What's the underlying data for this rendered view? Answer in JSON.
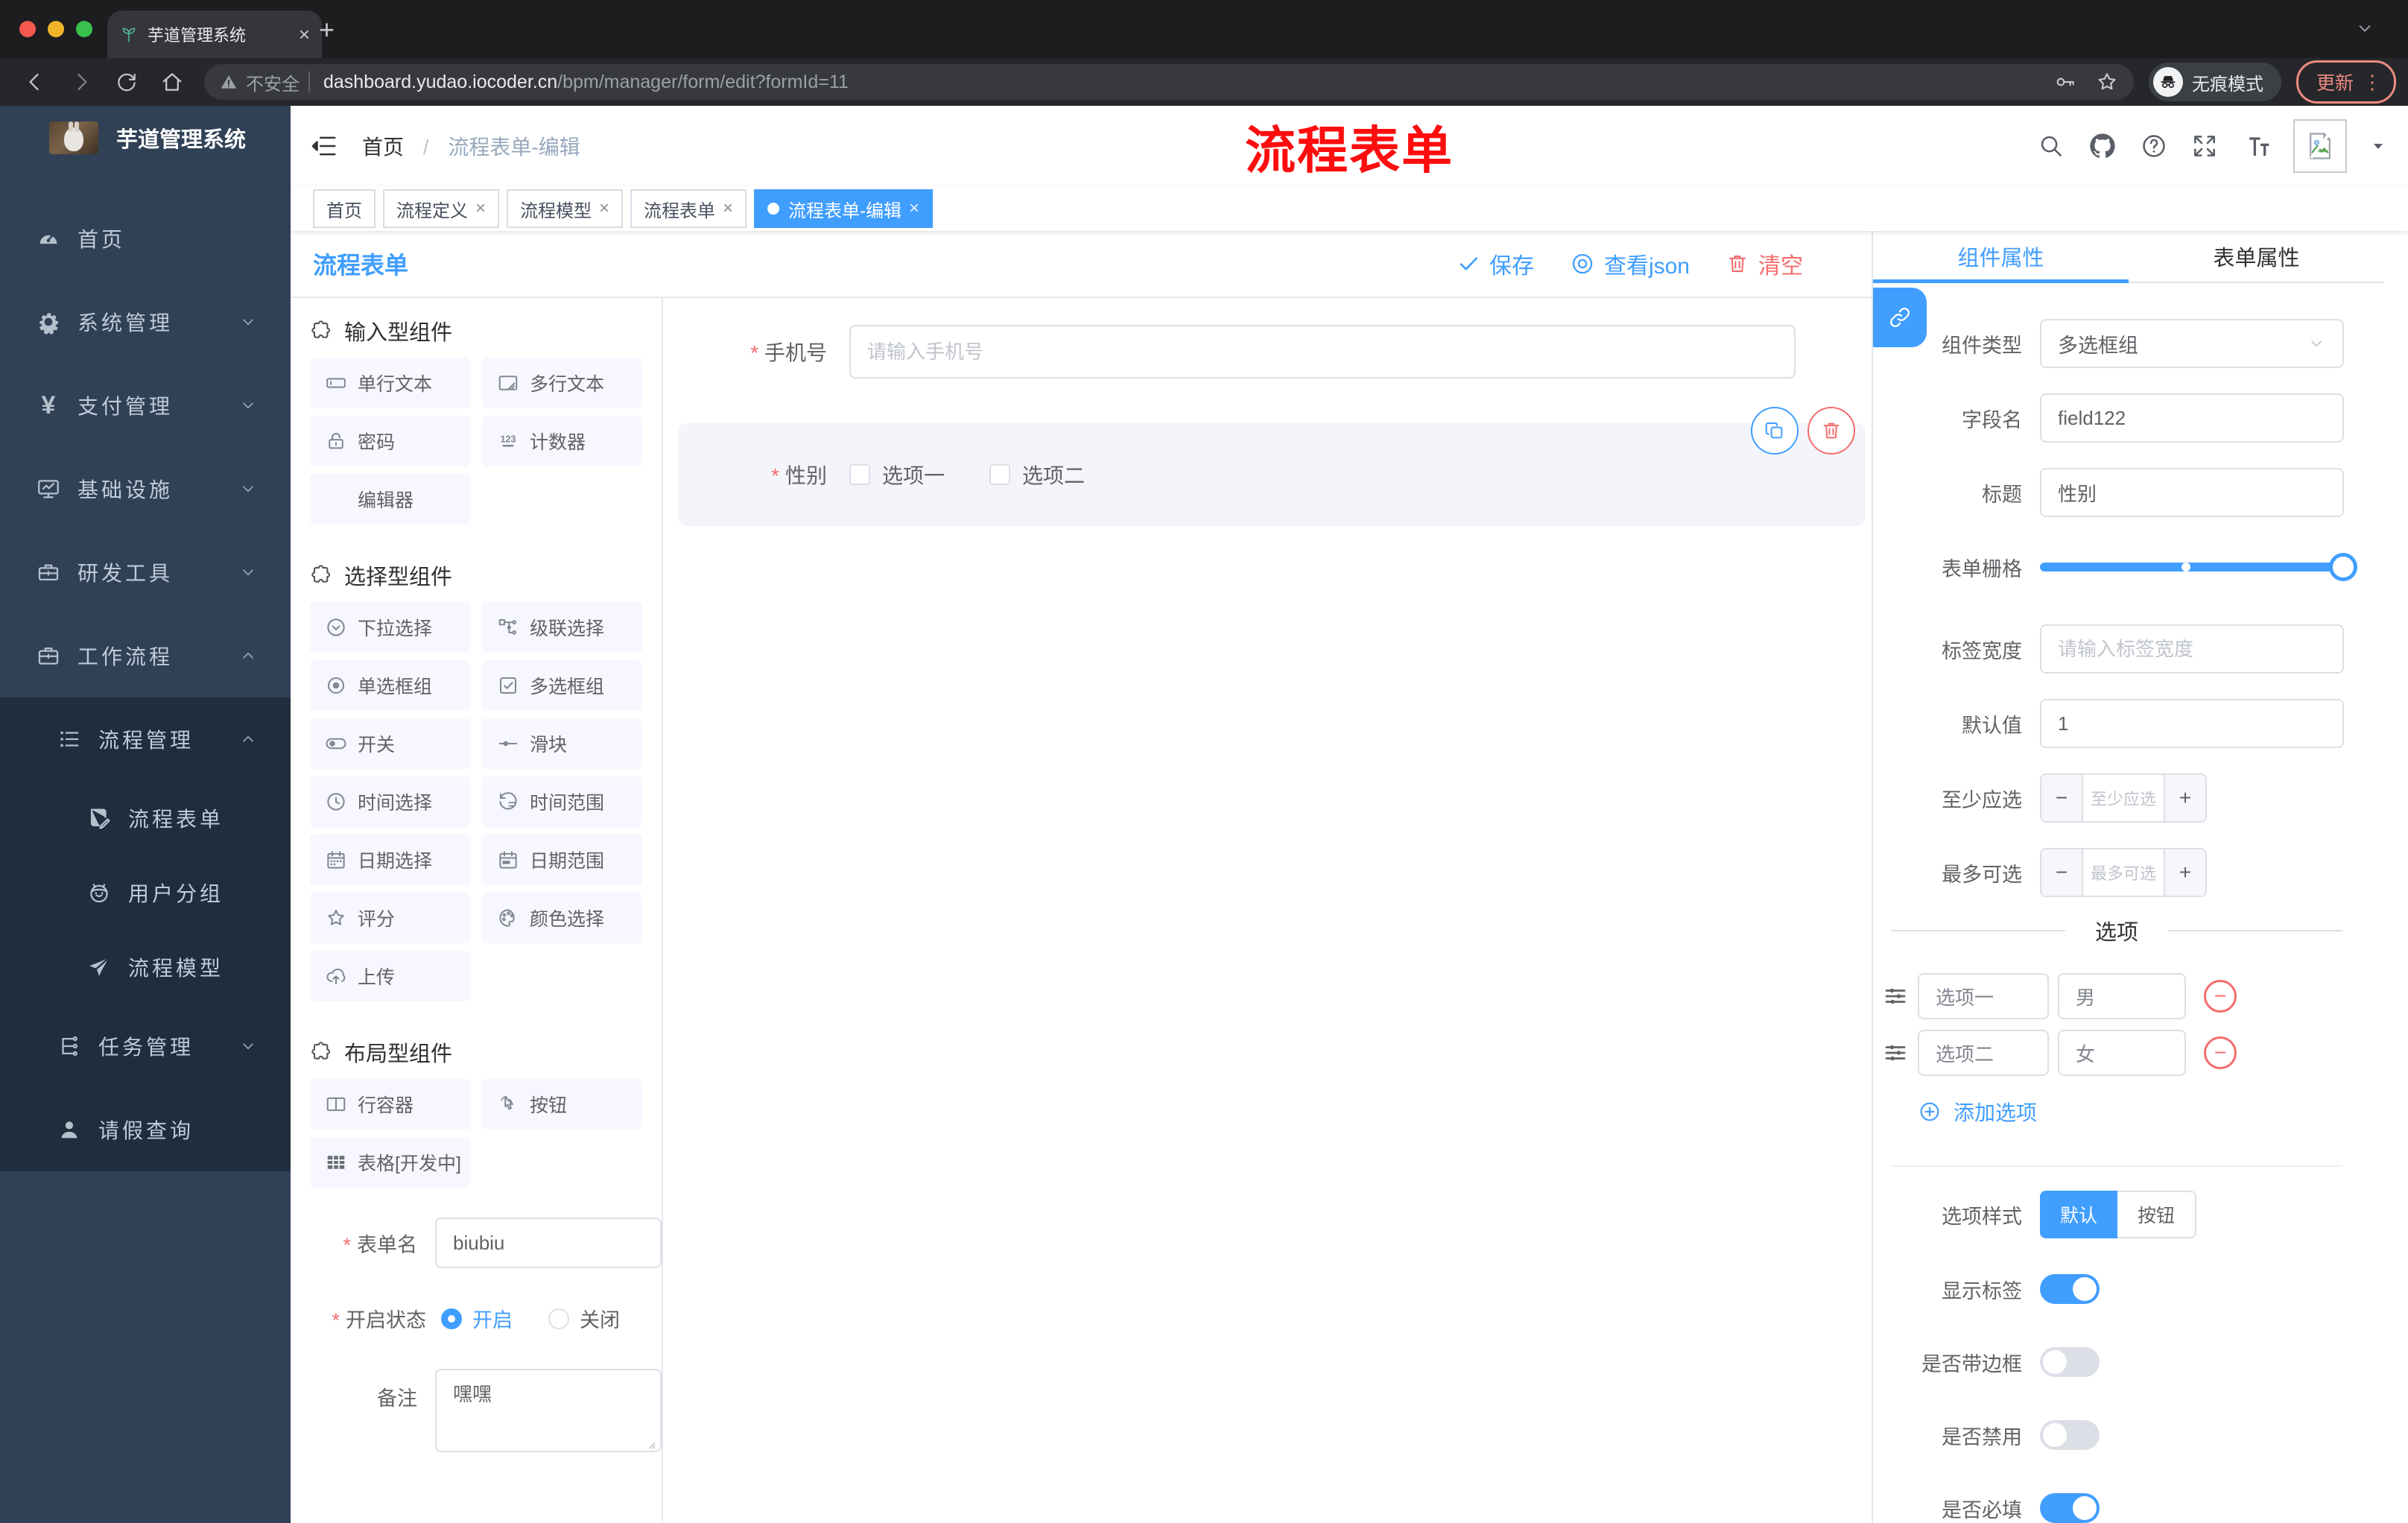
{
  "colors": {
    "accent": "#409EFF",
    "danger": "#F56C6C",
    "sidebar_bg": "#304156",
    "submenu_bg": "#1F2D3D",
    "tab_active_bg": "#409EFF"
  },
  "browser": {
    "tab_title": "芋道管理系统",
    "not_secure": "不安全",
    "url_domain": "dashboard.yudao.iocoder.cn",
    "url_path": "/bpm/manager/form/edit?formId=11",
    "incognito_label": "无痕模式",
    "update_label": "更新"
  },
  "sidebar": {
    "title": "芋道管理系统",
    "items": [
      {
        "label": "首页"
      },
      {
        "label": "系统管理"
      },
      {
        "label": "支付管理"
      },
      {
        "label": "基础设施"
      },
      {
        "label": "研发工具"
      },
      {
        "label": "工作流程"
      },
      {
        "label": "流程管理"
      },
      {
        "label": "流程表单"
      },
      {
        "label": "用户分组"
      },
      {
        "label": "流程模型"
      },
      {
        "label": "任务管理"
      },
      {
        "label": "请假查询"
      }
    ]
  },
  "header": {
    "breadcrumb_home": "首页",
    "breadcrumb_sep": "/",
    "breadcrumb_current": "流程表单-编辑",
    "annotation": "流程表单"
  },
  "tags": [
    {
      "label": "首页"
    },
    {
      "label": "流程定义"
    },
    {
      "label": "流程模型"
    },
    {
      "label": "流程表单"
    },
    {
      "label": "流程表单-编辑"
    }
  ],
  "designer": {
    "title": "流程表单",
    "save_label": "保存",
    "view_json_label": "查看json",
    "clear_label": "清空",
    "sections": [
      {
        "title": "输入型组件",
        "items": [
          "单行文本",
          "多行文本",
          "密码",
          "计数器",
          "编辑器"
        ]
      },
      {
        "title": "选择型组件",
        "items": [
          "下拉选择",
          "级联选择",
          "单选框组",
          "多选框组",
          "开关",
          "滑块",
          "时间选择",
          "时间范围",
          "日期选择",
          "日期范围",
          "评分",
          "颜色选择",
          "上传"
        ]
      },
      {
        "title": "布局型组件",
        "items": [
          "行容器",
          "按钮",
          "表格[开发中]"
        ]
      }
    ],
    "form": {
      "name_label": "表单名",
      "name_value": "biubiu",
      "status_label": "开启状态",
      "status_on": "开启",
      "status_off": "关闭",
      "remark_label": "备注",
      "remark_value": "嘿嘿"
    }
  },
  "canvas": {
    "phone_label": "手机号",
    "phone_placeholder": "请输入手机号",
    "gender_label": "性别",
    "gender_option1": "选项一",
    "gender_option2": "选项二"
  },
  "props": {
    "tab_component": "组件属性",
    "tab_form": "表单属性",
    "type_label": "组件类型",
    "type_value": "多选框组",
    "field_label": "字段名",
    "field_value": "field122",
    "title_label": "标题",
    "title_value": "性别",
    "grid_label": "表单栅格",
    "label_width_label": "标签宽度",
    "label_width_placeholder": "请输入标签宽度",
    "default_label": "默认值",
    "default_value": "1",
    "min_label": "至少应选",
    "min_placeholder": "至少应选",
    "max_label": "最多可选",
    "max_placeholder": "最多可选",
    "options_title": "选项",
    "options": [
      {
        "label": "选项一",
        "value": "男"
      },
      {
        "label": "选项二",
        "value": "女"
      }
    ],
    "add_option_label": "添加选项",
    "style_label": "选项样式",
    "style_default": "默认",
    "style_button": "按钮",
    "switch_show_label": "显示标签",
    "switch_border_label": "是否带边框",
    "switch_disabled_label": "是否禁用",
    "switch_required_label": "是否必填"
  }
}
